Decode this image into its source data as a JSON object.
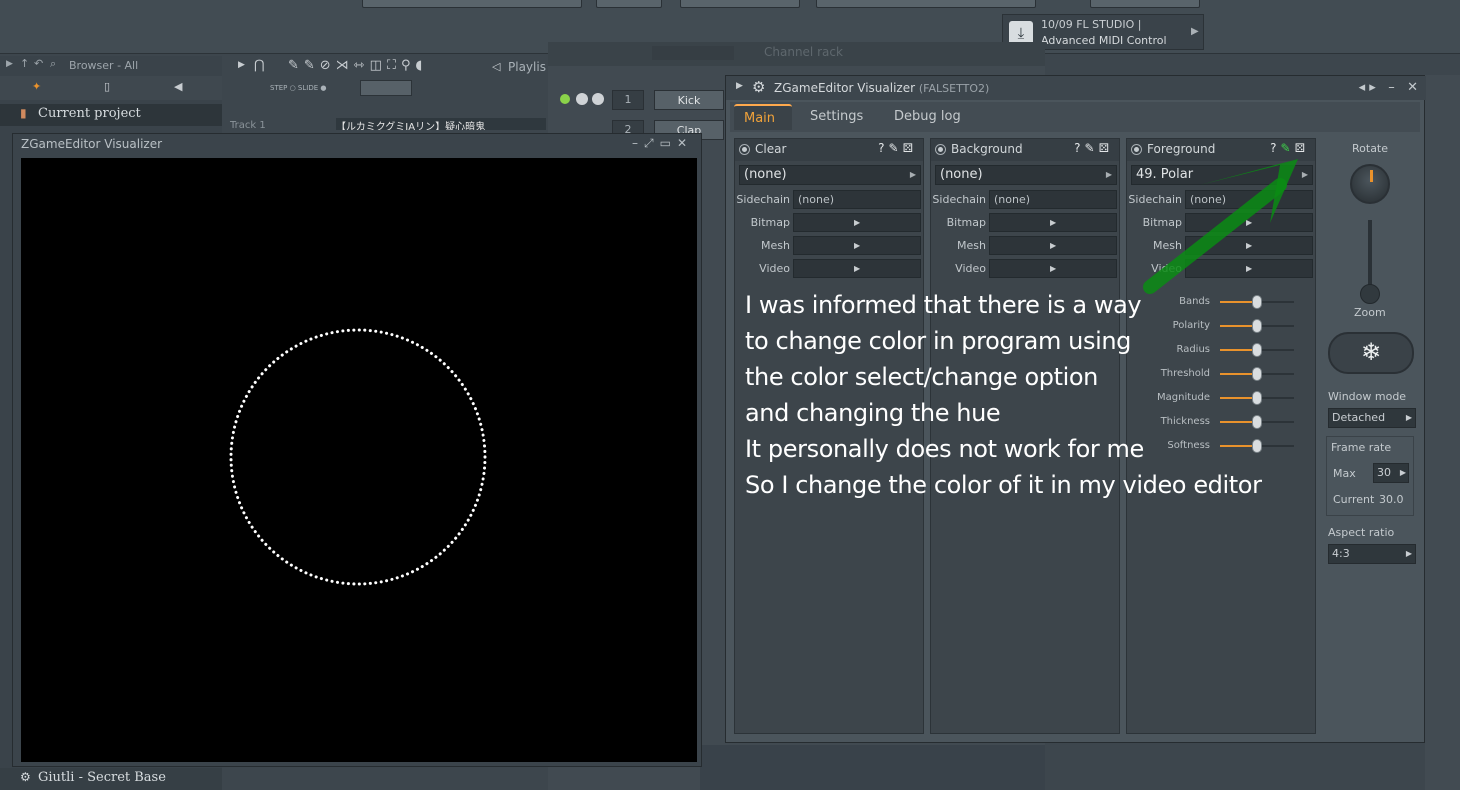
{
  "hint_bar": {
    "line1": "10/09  FL STUDIO |",
    "line2": "Advanced MIDI Control"
  },
  "browser": {
    "header": "Browser - All",
    "current_project": "Current project",
    "footer_song": "Giutli - Secret Base"
  },
  "playlist": {
    "label": "Playlis",
    "track": "Track 1",
    "song_clip": "【ルカミクグミIAリン】疑心暗鬼"
  },
  "channel_rack": {
    "title": "Channel rack",
    "channels": [
      {
        "number": "1",
        "name": "Kick"
      },
      {
        "number": "2",
        "name": "Clap"
      }
    ]
  },
  "visualizer_window": {
    "title": "ZGameEditor Visualizer"
  },
  "zge": {
    "title": "ZGameEditor Visualizer",
    "subtitle": "(FALSETTO2)",
    "tabs": [
      "Main",
      "Settings",
      "Debug log"
    ],
    "active_tab": "Main",
    "panels": [
      {
        "title": "Clear",
        "effect": "(none)",
        "sidechain": "(none)"
      },
      {
        "title": "Background",
        "effect": "(none)",
        "sidechain": "(none)"
      },
      {
        "title": "Foreground",
        "effect": "49. Polar",
        "sidechain": "(none)"
      }
    ],
    "field_labels": {
      "sidechain": "Sidechain",
      "bitmap": "Bitmap",
      "mesh": "Mesh",
      "video": "Video"
    },
    "sliders": [
      {
        "label": "Bands",
        "value": 0.5
      },
      {
        "label": "Polarity",
        "value": 0.5
      },
      {
        "label": "Radius",
        "value": 0.5
      },
      {
        "label": "Threshold",
        "value": 0.5
      },
      {
        "label": "Magnitude",
        "value": 0.5
      },
      {
        "label": "Thickness",
        "value": 0.5
      },
      {
        "label": "Softness",
        "value": 0.5
      }
    ],
    "side": {
      "rotate": "Rotate",
      "zoom": "Zoom",
      "window_mode_label": "Window mode",
      "window_mode": "Detached",
      "frame_rate_label": "Frame rate",
      "max_label": "Max",
      "max_value": "30",
      "current_label": "Current",
      "current_value": "30.0",
      "aspect_label": "Aspect ratio",
      "aspect_value": "4:3"
    }
  },
  "note_lines": [
    "I was informed that there is a way",
    "to change color in program using",
    "the color select/change option",
    "and changing the hue",
    "It personally does not work for me",
    "So I change the color of it in my video editor"
  ],
  "colors": {
    "accent_orange": "#f0a23a",
    "annotation_arrow": "#0a8c14",
    "circle_dots": "#ffffff"
  },
  "icons": [
    "download-icon",
    "gear-icon",
    "snowflake-icon",
    "help-icon",
    "palette-icon",
    "random-icon"
  ]
}
